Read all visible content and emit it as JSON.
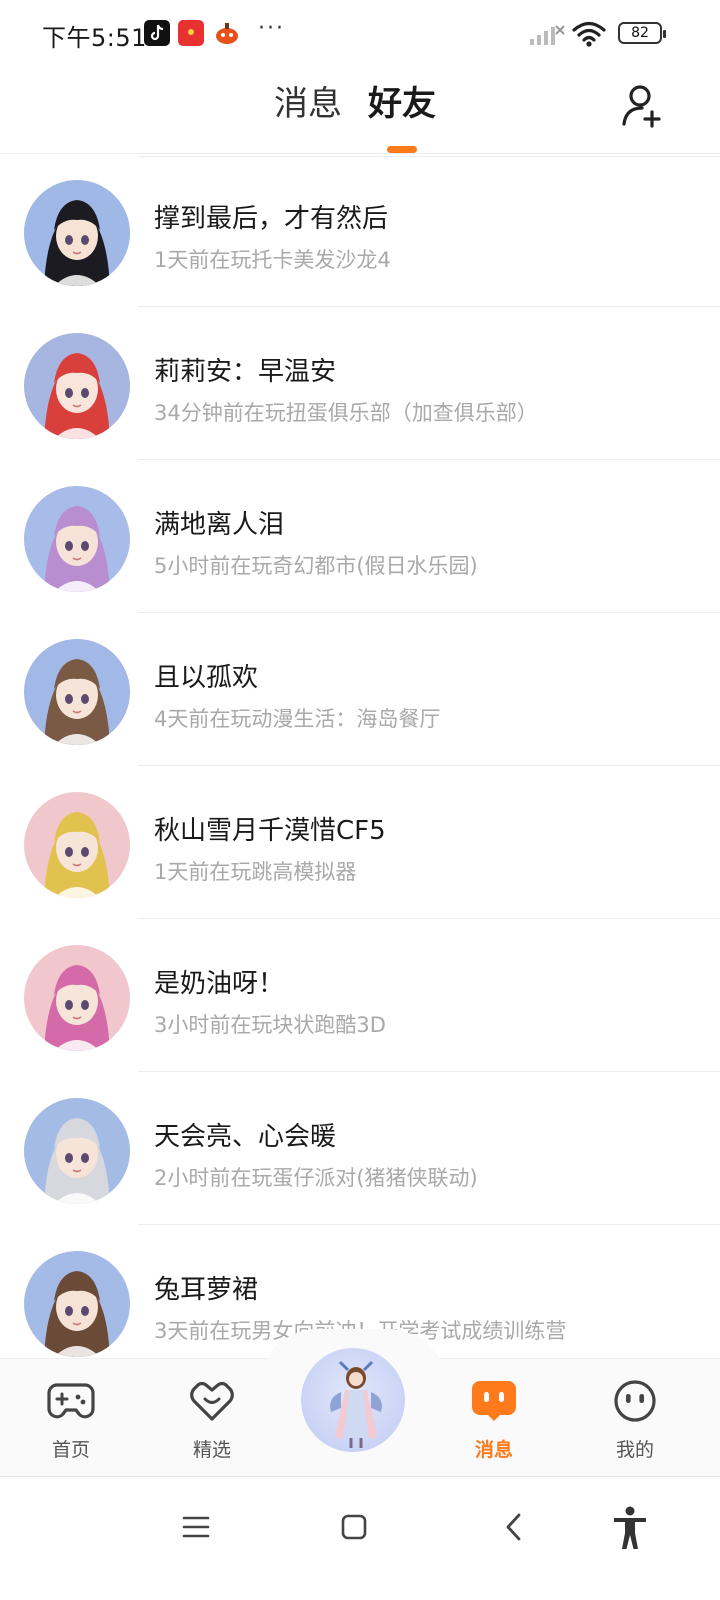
{
  "status_bar": {
    "time": "下午5:51",
    "more": "···",
    "battery": "82"
  },
  "header": {
    "tabs": [
      {
        "label": "消息",
        "active": false
      },
      {
        "label": "好友",
        "active": true
      }
    ],
    "accent_color": "#ff7a1a"
  },
  "friends": [
    {
      "name": "撑到最后，才有然后",
      "activity": "1天前在玩托卡美发沙龙4",
      "avatar_bg": "#9fb8e6",
      "hair": "#1d1b22",
      "skin": "#f7e3d6"
    },
    {
      "name": "莉莉安：早温安",
      "activity": "34分钟前在玩扭蛋俱乐部（加查俱乐部）",
      "avatar_bg": "#a6b6e0",
      "hair": "#d9403c",
      "skin": "#f9e5dc"
    },
    {
      "name": "满地离人泪",
      "activity": "5小时前在玩奇幻都市(假日水乐园)",
      "avatar_bg": "#a7bce8",
      "hair": "#b98ed0",
      "skin": "#f6e2d6"
    },
    {
      "name": "且以孤欢",
      "activity": "4天前在玩动漫生活：海岛餐厅",
      "avatar_bg": "#a2b8e6",
      "hair": "#7a5a45",
      "skin": "#f7e4d8"
    },
    {
      "name": "秋山雪月千漠惜CF5",
      "activity": "1天前在玩跳高模拟器",
      "avatar_bg": "#f0c8cc",
      "hair": "#e2c24e",
      "skin": "#f6e4d8"
    },
    {
      "name": "是奶油呀！",
      "activity": "3小时前在玩块状跑酷3D",
      "avatar_bg": "#f1c6cd",
      "hair": "#d56aa8",
      "skin": "#f7e5d9"
    },
    {
      "name": "天会亮、心会暖",
      "activity": "2小时前在玩蛋仔派对(猪猪侠联动)",
      "avatar_bg": "#a4bbe6",
      "hair": "#d6d8de",
      "skin": "#f6e4d9"
    },
    {
      "name": "兔耳萝裙",
      "activity": "3天前在玩男女向前冲！开学考试成绩训练营",
      "avatar_bg": "#a5bbe7",
      "hair": "#6b4a38",
      "skin": "#f6e3d7"
    }
  ],
  "bottom_nav": {
    "items": [
      {
        "label": "首页",
        "icon": "gamepad-icon",
        "active": false
      },
      {
        "label": "精选",
        "icon": "heart-icon",
        "active": false
      },
      {
        "label": "消息",
        "icon": "chat-icon",
        "active": true
      },
      {
        "label": "我的",
        "icon": "smiley-icon",
        "active": false
      }
    ],
    "center": "avatar-character"
  },
  "system_nav": {
    "buttons": [
      "menu-icon",
      "home-square-icon",
      "back-icon",
      "accessibility-icon"
    ]
  }
}
